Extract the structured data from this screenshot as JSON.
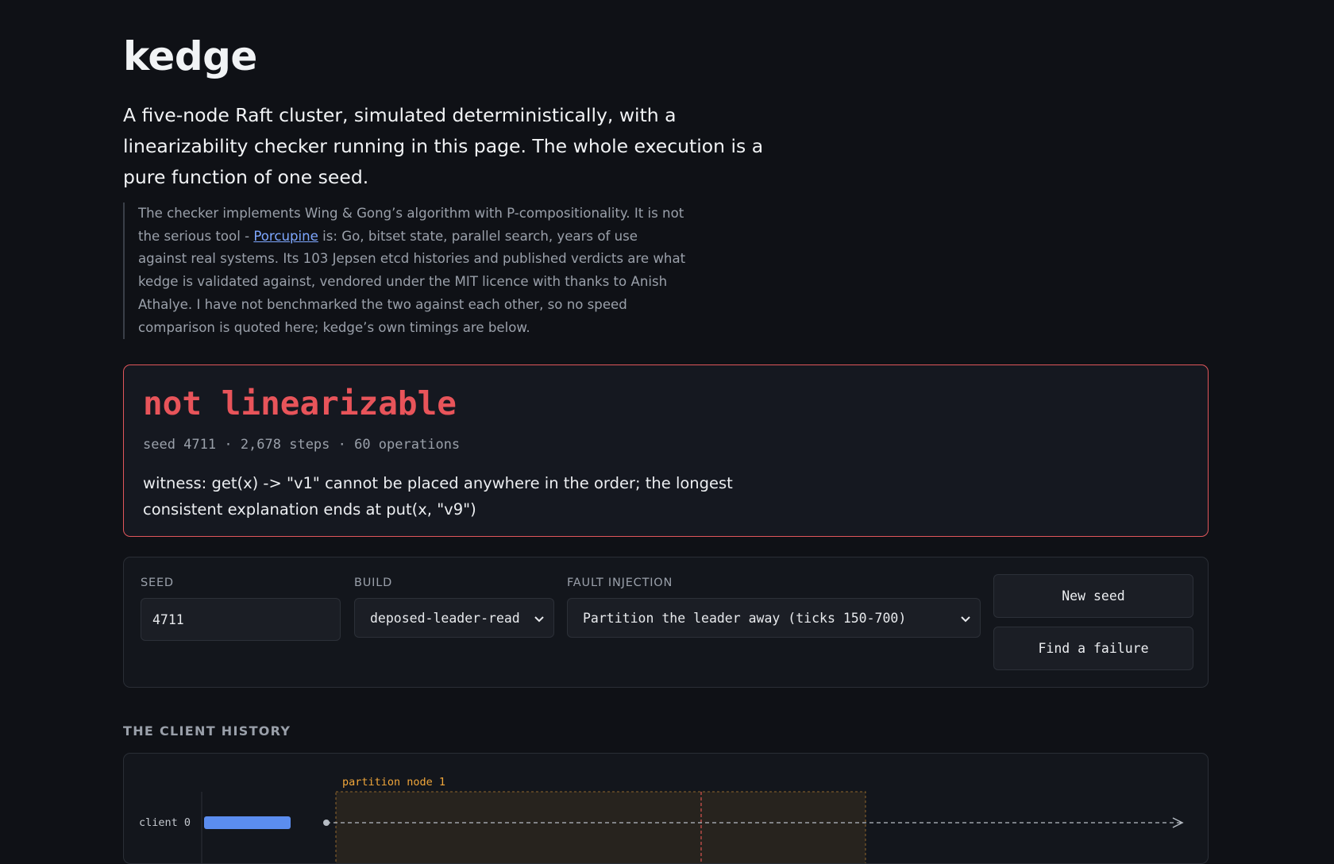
{
  "header": {
    "title": "kedge",
    "lede": "A five-node Raft cluster, simulated deterministically, with a linearizability checker running in this page. The whole execution is a pure function of one seed."
  },
  "note": {
    "text_before": "The checker implements Wing & Gong’s algorithm with P-compositionality. It is not the serious tool - ",
    "link_label": "Porcupine",
    "text_after": " is: Go, bitset state, parallel search, years of use against real systems. Its 103 Jepsen etcd histories and published verdicts are what kedge is validated against, vendored under the MIT licence with thanks to Anish Athalye. I have not benchmarked the two against each other, so no speed comparison is quoted here; kedge’s own timings are below."
  },
  "verdict": {
    "title": "not linearizable",
    "meta": "seed 4711 · 2,678 steps · 60 operations",
    "witness": "witness: get(x) -> \"v1\" cannot be placed anywhere in the order; the longest consistent explanation ends at put(x, \"v9\")",
    "accent_color": "#e8545a"
  },
  "controls": {
    "seed": {
      "label": "SEED",
      "value": "4711"
    },
    "build": {
      "label": "BUILD",
      "value": "deposed-leader-read"
    },
    "fault": {
      "label": "FAULT INJECTION",
      "value": "Partition the leader away (ticks 150-700)"
    },
    "new_seed_label": "New seed",
    "find_failure_label": "Find a failure"
  },
  "history": {
    "heading": "THE CLIENT HISTORY",
    "partition_label": "partition node 1",
    "client_label": "client 0",
    "colors": {
      "op": "#5b8def",
      "partition": "#f0a63a",
      "marker": "#d9534f"
    }
  }
}
